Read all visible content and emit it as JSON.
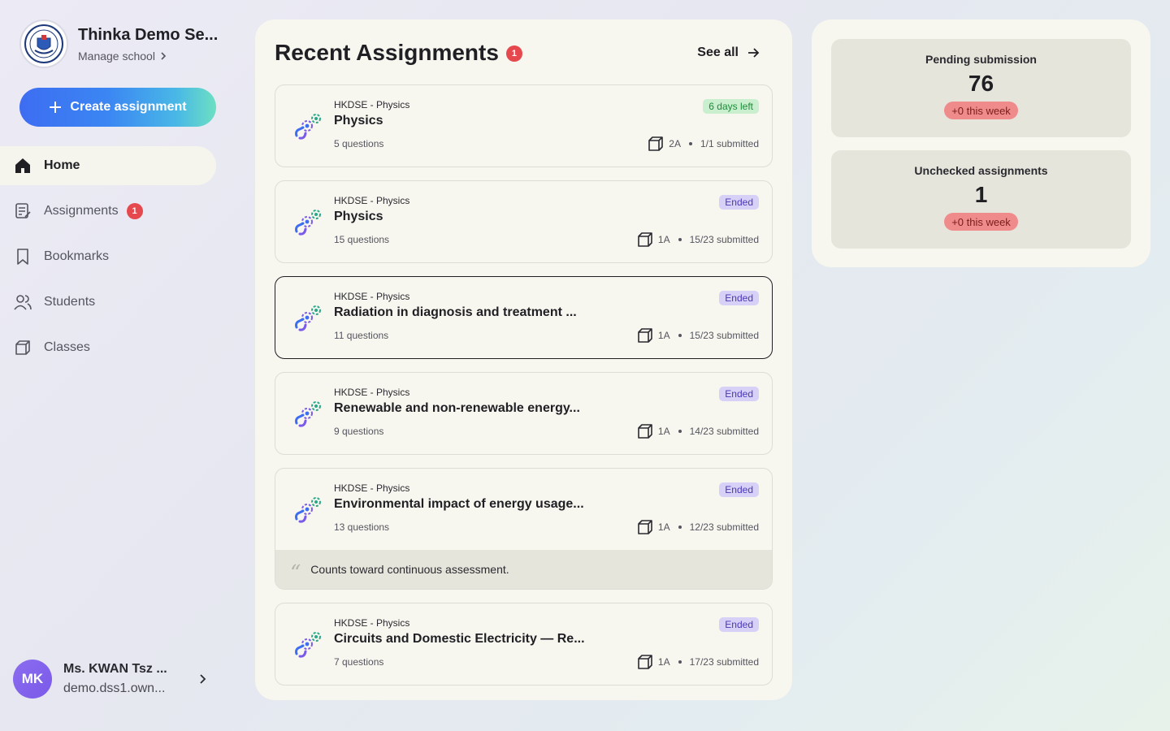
{
  "sidebar": {
    "school_name": "Thinka Demo Se...",
    "manage_label": "Manage school",
    "create_label": "Create assignment",
    "nav": [
      {
        "label": "Home",
        "icon": "home-icon",
        "active": true
      },
      {
        "label": "Assignments",
        "icon": "assignments-icon",
        "badge": "1"
      },
      {
        "label": "Bookmarks",
        "icon": "bookmark-icon"
      },
      {
        "label": "Students",
        "icon": "students-icon"
      },
      {
        "label": "Classes",
        "icon": "classes-icon"
      }
    ],
    "user": {
      "initials": "MK",
      "name": "Ms. KWAN Tsz ...",
      "email": "demo.dss1.own..."
    }
  },
  "main": {
    "title": "Recent Assignments",
    "badge": "1",
    "see_all": "See all",
    "cards": [
      {
        "subject": "HKDSE - Physics",
        "title": "Physics",
        "questions": "5 questions",
        "status": "6 days left",
        "class": "2A",
        "submitted": "1/1 submitted"
      },
      {
        "subject": "HKDSE - Physics",
        "title": "Physics",
        "questions": "15 questions",
        "status": "Ended",
        "class": "1A",
        "submitted": "15/23 submitted"
      },
      {
        "subject": "HKDSE - Physics",
        "title": "Radiation in diagnosis and treatment ...",
        "questions": "11 questions",
        "status": "Ended",
        "class": "1A",
        "submitted": "15/23 submitted"
      },
      {
        "subject": "HKDSE - Physics",
        "title": "Renewable and non-renewable energy...",
        "questions": "9 questions",
        "status": "Ended",
        "class": "1A",
        "submitted": "14/23 submitted"
      },
      {
        "subject": "HKDSE - Physics",
        "title": "Environmental impact of energy usage...",
        "questions": "13 questions",
        "status": "Ended",
        "class": "1A",
        "submitted": "12/23 submitted",
        "note": "Counts toward continuous assessment."
      },
      {
        "subject": "HKDSE - Physics",
        "title": "Circuits and Domestic Electricity — Re...",
        "questions": "7 questions",
        "status": "Ended",
        "class": "1A",
        "submitted": "17/23 submitted"
      }
    ]
  },
  "stats": [
    {
      "label": "Pending submission",
      "value": "76",
      "delta": "+0 this week"
    },
    {
      "label": "Unchecked assignments",
      "value": "1",
      "delta": "+0 this week"
    }
  ],
  "colors": {
    "accent_red": "#e5484d",
    "panel": "#f7f6ef",
    "tag_green": "#c9efcf",
    "tag_purple": "#d8d1f7"
  }
}
